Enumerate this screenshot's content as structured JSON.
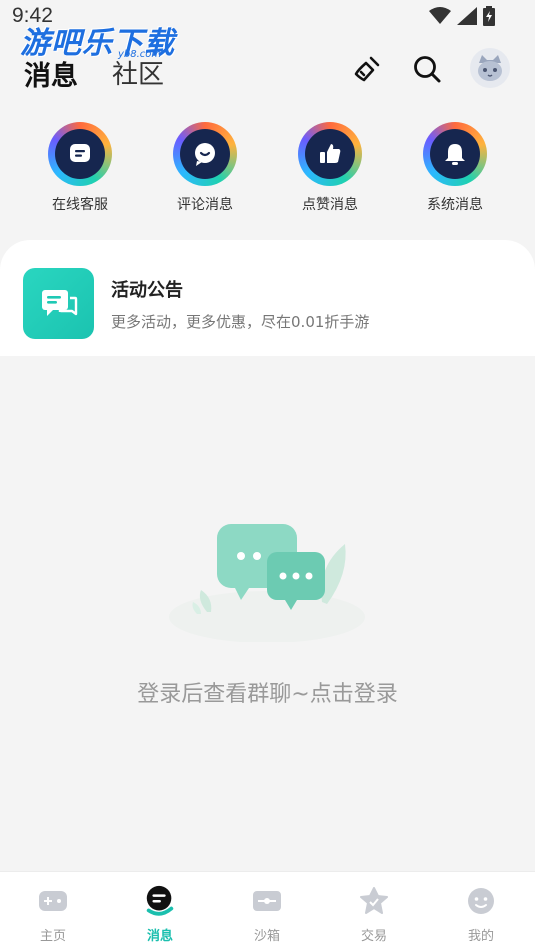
{
  "status": {
    "time": "9:42"
  },
  "watermark": {
    "text": "游吧乐下载",
    "sub": "yb8.com"
  },
  "header": {
    "tabs": [
      {
        "label": "消息",
        "active": true
      },
      {
        "label": "社区",
        "active": false
      }
    ],
    "icons": [
      "broom-icon",
      "search-icon",
      "avatar"
    ]
  },
  "quick_actions": [
    {
      "label": "在线客服",
      "icon": "customer-service-icon"
    },
    {
      "label": "评论消息",
      "icon": "comment-icon"
    },
    {
      "label": "点赞消息",
      "icon": "thumbs-up-icon"
    },
    {
      "label": "系统消息",
      "icon": "bell-icon"
    }
  ],
  "announcement": {
    "title": "活动公告",
    "subtitle": "更多活动，更多优惠，尽在0.01折手游",
    "icon": "chat-bubbles-icon",
    "color": "#1fc9b5"
  },
  "empty_state": {
    "text": "登录后查看群聊~点击登录"
  },
  "bottom_nav": [
    {
      "label": "主页",
      "icon": "gamepad-icon",
      "active": false
    },
    {
      "label": "消息",
      "icon": "message-icon",
      "active": true
    },
    {
      "label": "沙箱",
      "icon": "sandbox-icon",
      "active": false
    },
    {
      "label": "交易",
      "icon": "trade-icon",
      "active": false
    },
    {
      "label": "我的",
      "icon": "profile-icon",
      "active": false
    }
  ],
  "colors": {
    "accent": "#1bbfae",
    "background": "#f4f4f4",
    "icon_dark": "#16264f"
  }
}
